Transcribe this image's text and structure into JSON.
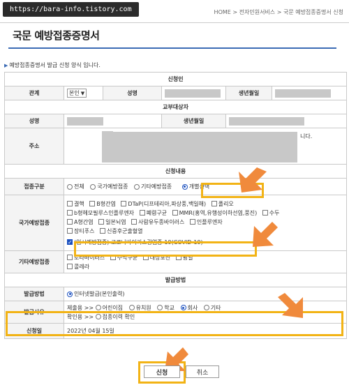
{
  "watermark": "https://bara-info.tistory.com",
  "breadcrumb": {
    "home": "HOME",
    "sep": ">",
    "l1": "전자민원서비스",
    "l2": "국문 예방접종증명서 신청"
  },
  "page_title": "국문 예방접종증명서",
  "notice": "예방접종증명서 발급 신청 양식 입니다.",
  "applicant": {
    "header": "신청인",
    "relation_label": "관계",
    "relation_value": "본인",
    "name_label": "성명",
    "birth_label": "생년월일"
  },
  "subject": {
    "header": "교부대상자",
    "name_label": "성명",
    "birth_label": "생년월일",
    "address_label": "주소",
    "address_suffix": "니다."
  },
  "content": {
    "header": "신청내용",
    "type_label": "접종구분",
    "type_options": [
      "전체",
      "국가예방접종",
      "기타예방접종",
      "개별선택"
    ],
    "national_label": "국가예방접종",
    "national_items": [
      "결핵",
      "B형간염",
      "DTaP(디프테리아,파상풍,백일해)",
      "폴리오",
      "b형헤모필루스인플루엔자",
      "폐렴구균",
      "MMR(홍역,유행성이하선염,풍진)",
      "수두",
      "A형간염",
      "일본뇌염",
      "사람유두종바이러스",
      "인플루엔자",
      "장티푸스",
      "신증후군출혈열"
    ],
    "covid_item": "(임시예방접종) 코로나바이러스감염증-19(COVID-19)",
    "other_label": "기타예방접종",
    "other_items": [
      "로타바이러스",
      "수막구균",
      "대상포진",
      "황열",
      "콜레라"
    ]
  },
  "issue": {
    "header": "발급방법",
    "method_label": "발급방법",
    "method_value": "인터넷발급(본인출력)",
    "reason_label": "발급사유",
    "submit_to": "제출용 >>",
    "submit_options": [
      "어린이집",
      "유치원",
      "학교",
      "회사",
      "기타"
    ],
    "check_to": "확인용 >>",
    "check_option": "접종이력 확인",
    "date_label": "신청일",
    "date_value": "2022년 04월 15일"
  },
  "buttons": {
    "apply": "신청",
    "cancel": "취소"
  },
  "colors": {
    "highlight": "#f2b315",
    "arrow": "#f08a3c",
    "accent": "#3b6bb5"
  }
}
